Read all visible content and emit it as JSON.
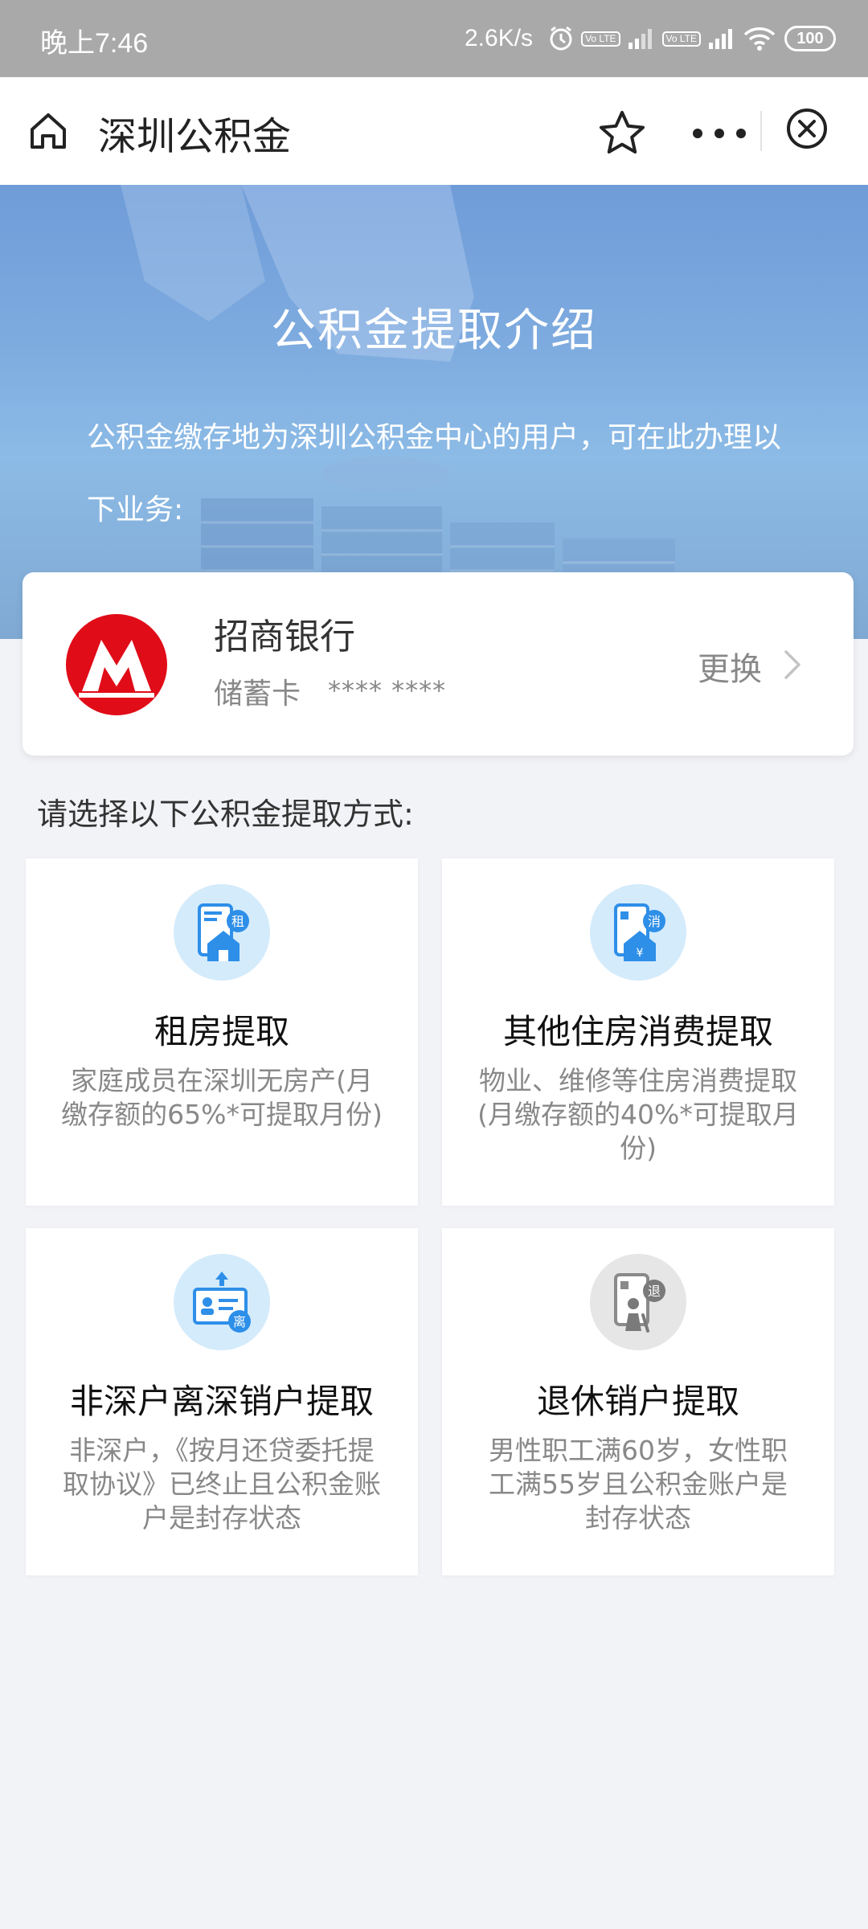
{
  "status_bar": {
    "time": "晚上7:46",
    "net_speed": "2.6K/s",
    "volte_1": "Vo LTE",
    "volte_2": "Vo LTE",
    "battery": "100"
  },
  "header": {
    "title": "深圳公积金"
  },
  "banner": {
    "title": "公积金提取介绍",
    "description": "公积金缴存地为深圳公积金中心的用户，可在此办理以下业务:"
  },
  "bank_card": {
    "bank_name": "招商银行",
    "card_type": "储蓄卡",
    "card_number": "**** ****",
    "change_label": "更换"
  },
  "section": {
    "title": "请选择以下公积金提取方式:"
  },
  "options": [
    {
      "badge": "租",
      "title": "租房提取",
      "description": "家庭成员在深圳无房产(月缴存额的65%*可提取月份)"
    },
    {
      "badge": "消",
      "title": "其他住房消费提取",
      "description": "物业、维修等住房消费提取(月缴存额的40%*可提取月份)"
    },
    {
      "badge": "离",
      "title": "非深户离深销户提取",
      "description": "非深户，《按月还贷委托提取协议》已终止且公积金账户是封存状态"
    },
    {
      "badge": "退",
      "title": "退休销户提取",
      "description": "男性职工满60岁，女性职工满55岁且公积金账户是封存状态"
    }
  ],
  "colors": {
    "accent_blue": "#2e8fe8",
    "bank_red": "#e00c18",
    "icon_bg_blue": "#d4ebfb",
    "icon_bg_gray": "#e6e6e6"
  }
}
